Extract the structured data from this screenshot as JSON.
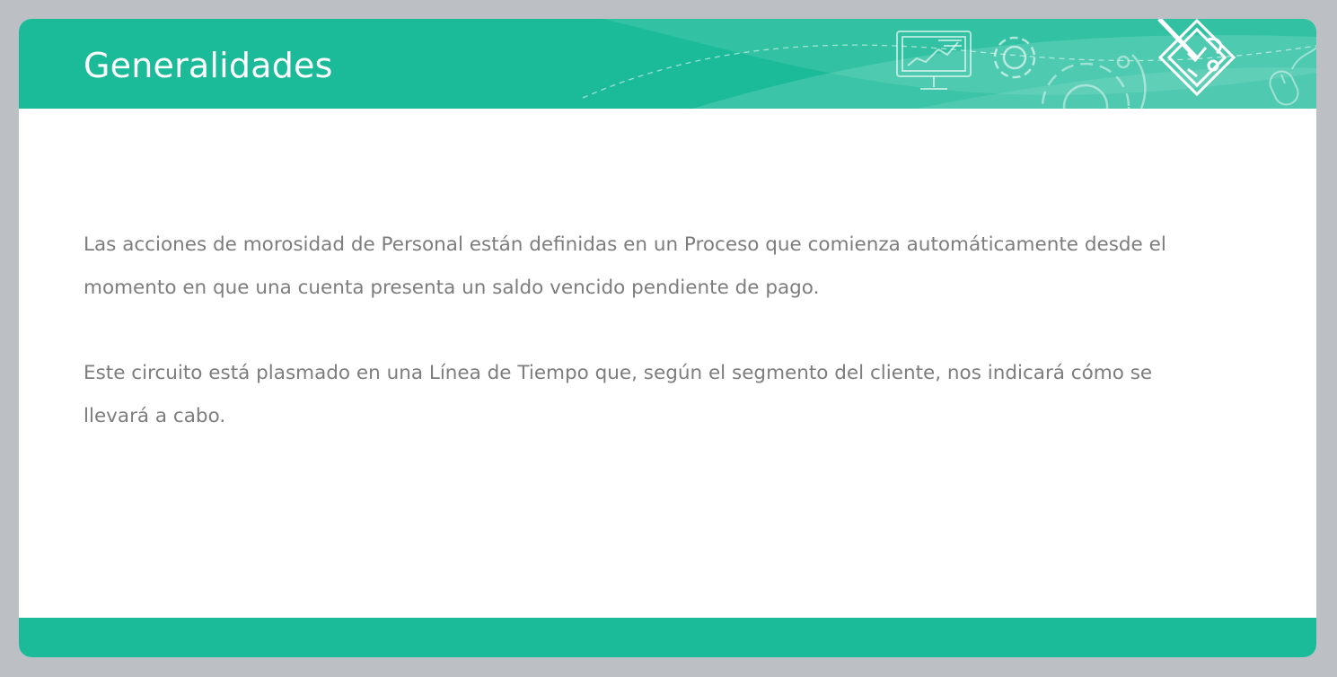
{
  "slide": {
    "title": "Generalidades",
    "paragraphs": [
      "Las acciones de morosidad de Personal están definidas en un Proceso que comienza automáticamente desde el momento en que una cuenta presenta un saldo vencido pendiente de pago.",
      "Este circuito está plasmado en una Línea de Tiempo que, según el segmento del cliente, nos indicará cómo se llevará a cabo."
    ]
  },
  "header_icons": [
    "presentation-board-icon",
    "gear-icon",
    "large-gear-icon",
    "checklist-pencil-icon",
    "computer-mouse-icon"
  ],
  "colors": {
    "accent": "#1bbb99",
    "background": "#bcc0c4",
    "slide": "#ffffff",
    "text": "#7d7d7d",
    "title": "#ffffff"
  }
}
